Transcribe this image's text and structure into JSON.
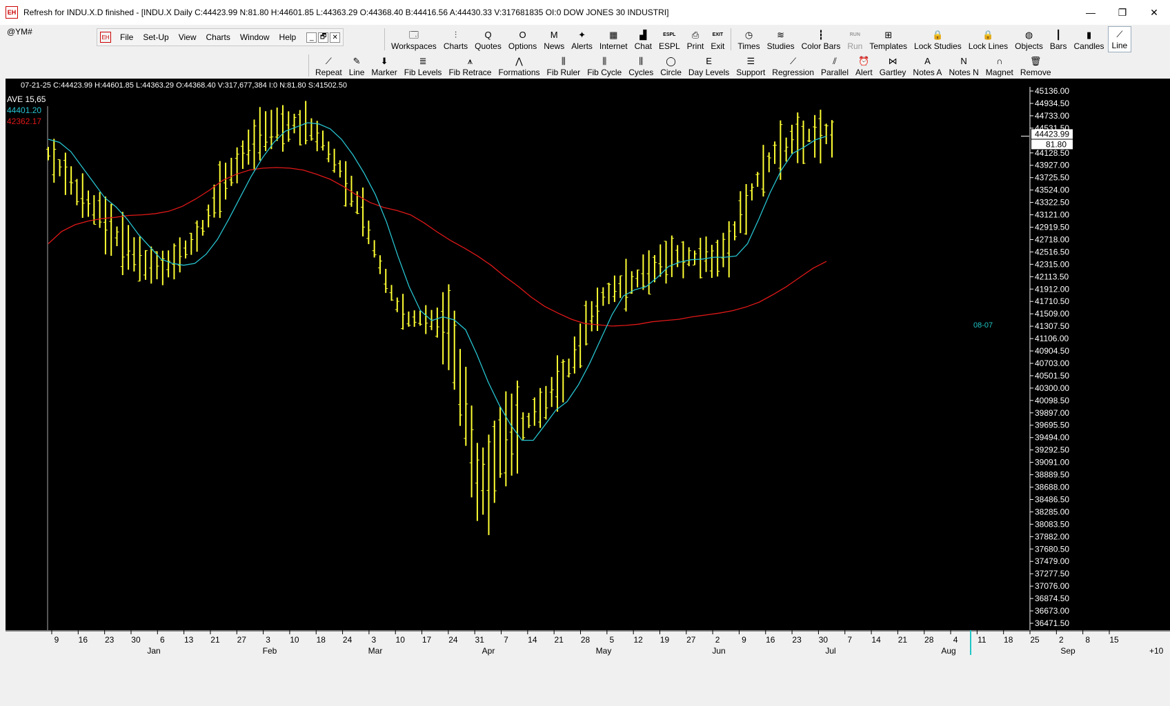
{
  "window": {
    "title": "Refresh for INDU.X.D finished - [INDU.X Daily C:44423.99 N:81.80 H:44601.85 L:44363.29 O:44368.40 B:44416.56 A:44430.33 V:317681835 OI:0 DOW JONES 30 INDUSTRI]",
    "app_icon": "EH",
    "minimize": "—",
    "restore": "❐",
    "close": "✕"
  },
  "symbol": "@YM#",
  "menu": {
    "items": [
      "File",
      "Set-Up",
      "View",
      "Charts",
      "Window",
      "Help"
    ],
    "mdi_controls": [
      "_",
      "🗗",
      "✕"
    ]
  },
  "toolbar_row1": [
    {
      "label": "Workspaces",
      "icon": "workspaces-icon",
      "glyph": "🗔"
    },
    {
      "label": "Charts",
      "icon": "charts-icon",
      "glyph": "⫶"
    },
    {
      "label": "Quotes",
      "icon": "quotes-icon",
      "glyph": "Q"
    },
    {
      "label": "Options",
      "icon": "options-icon",
      "glyph": "O"
    },
    {
      "label": "News",
      "icon": "news-icon",
      "glyph": "M"
    },
    {
      "label": "Alerts",
      "icon": "alerts-icon",
      "glyph": "✦"
    },
    {
      "label": "Internet",
      "icon": "internet-icon",
      "glyph": "▦"
    },
    {
      "label": "Chat",
      "icon": "chat-icon",
      "glyph": "▟"
    },
    {
      "label": "ESPL",
      "icon": "espl-icon",
      "glyph": "ESPL"
    },
    {
      "label": "Print",
      "icon": "print-icon",
      "glyph": "⎙"
    },
    {
      "label": "Exit",
      "icon": "exit-icon",
      "glyph": "EXIT"
    },
    {
      "label": "Times",
      "icon": "times-icon",
      "glyph": "◷"
    },
    {
      "label": "Studies",
      "icon": "studies-icon",
      "glyph": "≋"
    },
    {
      "label": "Color Bars",
      "icon": "color-bars-icon",
      "glyph": "┇"
    },
    {
      "label": "Run",
      "icon": "run-icon",
      "glyph": "RUN"
    },
    {
      "label": "Templates",
      "icon": "templates-icon",
      "glyph": "⊞"
    },
    {
      "label": "Lock Studies",
      "icon": "lock-studies-icon",
      "glyph": "🔒"
    },
    {
      "label": "Lock Lines",
      "icon": "lock-lines-icon",
      "glyph": "🔒"
    },
    {
      "label": "Objects",
      "icon": "objects-icon",
      "glyph": "◍"
    },
    {
      "label": "Bars",
      "icon": "bars-icon",
      "glyph": "┃"
    },
    {
      "label": "Candles",
      "icon": "candles-icon",
      "glyph": "▮"
    },
    {
      "label": "Line",
      "icon": "line-chart-icon",
      "glyph": "⟋"
    }
  ],
  "toolbar_row2": [
    {
      "label": "Repeat",
      "icon": "repeat-icon",
      "glyph": "⟋"
    },
    {
      "label": "Line",
      "icon": "line-tool-icon",
      "glyph": "✎"
    },
    {
      "label": "Marker",
      "icon": "marker-icon",
      "glyph": "⬇"
    },
    {
      "label": "Fib Levels",
      "icon": "fib-levels-icon",
      "glyph": "≣"
    },
    {
      "label": "Fib Retrace",
      "icon": "fib-retrace-icon",
      "glyph": "⩚"
    },
    {
      "label": "Formations",
      "icon": "formations-icon",
      "glyph": "⋀"
    },
    {
      "label": "Fib Ruler",
      "icon": "fib-ruler-icon",
      "glyph": "⫼"
    },
    {
      "label": "Fib Cycle",
      "icon": "fib-cycle-icon",
      "glyph": "⫼"
    },
    {
      "label": "Cycles",
      "icon": "cycles-icon",
      "glyph": "⫼"
    },
    {
      "label": "Circle",
      "icon": "circle-icon",
      "glyph": "◯"
    },
    {
      "label": "Day Levels",
      "icon": "day-levels-icon",
      "glyph": "E"
    },
    {
      "label": "Support",
      "icon": "support-icon",
      "glyph": "☰"
    },
    {
      "label": "Regression",
      "icon": "regression-icon",
      "glyph": "⟋"
    },
    {
      "label": "Parallel",
      "icon": "parallel-icon",
      "glyph": "⫽"
    },
    {
      "label": "Alert",
      "icon": "alert-clock-icon",
      "glyph": "⏰"
    },
    {
      "label": "Gartley",
      "icon": "gartley-icon",
      "glyph": "⋈"
    },
    {
      "label": "Notes  A",
      "icon": "notes-a-icon",
      "glyph": "A"
    },
    {
      "label": "Notes  N",
      "icon": "notes-n-icon",
      "glyph": "N"
    },
    {
      "label": "Magnet",
      "icon": "magnet-icon",
      "glyph": "∩"
    },
    {
      "label": "Remove",
      "icon": "remove-icon",
      "glyph": "🗑"
    }
  ],
  "chart": {
    "info_line": "07-21-25    C:44423.99    H:44601.85    L:44363.29    O:44368.40    V:317,677,384    I:0    N:81.80    S:41502.50",
    "legend": {
      "ave_label": "AVE  15,65",
      "ma_fast_value": "44401.20",
      "ma_slow_value": "42362.17"
    },
    "date_flag": "08-07",
    "colors": {
      "background": "#000000",
      "bars": "#ffff33",
      "ma_fast": "#27c3d0",
      "ma_slow": "#e01818",
      "axis_text": "#ffffff"
    },
    "last_price_label": "44423.99",
    "last_change_label": "81.80"
  },
  "chart_data": {
    "type": "line",
    "title": "",
    "y_axis_labels": [
      "45136.00",
      "44934.50",
      "44733.00",
      "44531.50",
      "44128.50",
      "43927.00",
      "43725.50",
      "43524.00",
      "43322.50",
      "43121.00",
      "42919.50",
      "42718.00",
      "42516.50",
      "42315.00",
      "42113.50",
      "41912.00",
      "41710.50",
      "41509.00",
      "41307.50",
      "41106.00",
      "40904.50",
      "40703.00",
      "40501.50",
      "40300.00",
      "40098.50",
      "39897.00",
      "39695.50",
      "39494.00",
      "39292.50",
      "39091.00",
      "38889.50",
      "38688.00",
      "38486.50",
      "38285.00",
      "38083.50",
      "37882.00",
      "37680.50",
      "37479.00",
      "37277.50",
      "37076.00",
      "36874.50",
      "36673.00",
      "36471.50"
    ],
    "ylim": [
      36471.5,
      45136.0
    ],
    "x_day_labels": [
      "9",
      "16",
      "23",
      "30",
      "6",
      "13",
      "21",
      "27",
      "3",
      "10",
      "18",
      "24",
      "3",
      "10",
      "17",
      "24",
      "31",
      "7",
      "14",
      "21",
      "28",
      "5",
      "12",
      "19",
      "27",
      "2",
      "9",
      "16",
      "23",
      "30",
      "7",
      "14",
      "21",
      "28",
      "4",
      "11",
      "18",
      "25",
      "2",
      "8",
      "15"
    ],
    "x_month_labels": [
      "Jan",
      "Feb",
      "Mar",
      "Apr",
      "May",
      "Jun",
      "Jul",
      "Aug",
      "Sep"
    ],
    "scroll_controls": "+10",
    "series": [
      {
        "name": "44401.20",
        "values": [
          44350,
          44300,
          44150,
          43900,
          43650,
          43400,
          43250,
          43050,
          42800,
          42600,
          42400,
          42330,
          42300,
          42330,
          42480,
          42720,
          43050,
          43400,
          43750,
          44050,
          44300,
          44480,
          44550,
          44620,
          44600,
          44520,
          44350,
          44100,
          43800,
          43450,
          43000,
          42450,
          41950,
          41560,
          41400,
          41460,
          41410,
          41250,
          40850,
          40400,
          40020,
          39700,
          39450,
          39450,
          39690,
          39940,
          40080,
          40350,
          40700,
          41100,
          41500,
          41800,
          41900,
          41950,
          42100,
          42280,
          42350,
          42390,
          42400,
          42430,
          42430,
          42450,
          42650,
          43050,
          43480,
          43850,
          44120,
          44220,
          44340,
          44401.2
        ]
      },
      {
        "name": "42362.17",
        "values": [
          42650,
          42850,
          42960,
          43020,
          43060,
          43080,
          43110,
          43120,
          43140,
          43180,
          43260,
          43380,
          43520,
          43680,
          43780,
          43850,
          43880,
          43890,
          43880,
          43850,
          43780,
          43700,
          43580,
          43440,
          43320,
          43240,
          43190,
          43120,
          42990,
          42840,
          42700,
          42580,
          42450,
          42300,
          42120,
          41960,
          41780,
          41630,
          41520,
          41420,
          41350,
          41330,
          41310,
          41320,
          41340,
          41380,
          41400,
          41420,
          41460,
          41490,
          41520,
          41560,
          41620,
          41700,
          41820,
          41950,
          42100,
          42250,
          42362.17
        ]
      }
    ]
  }
}
